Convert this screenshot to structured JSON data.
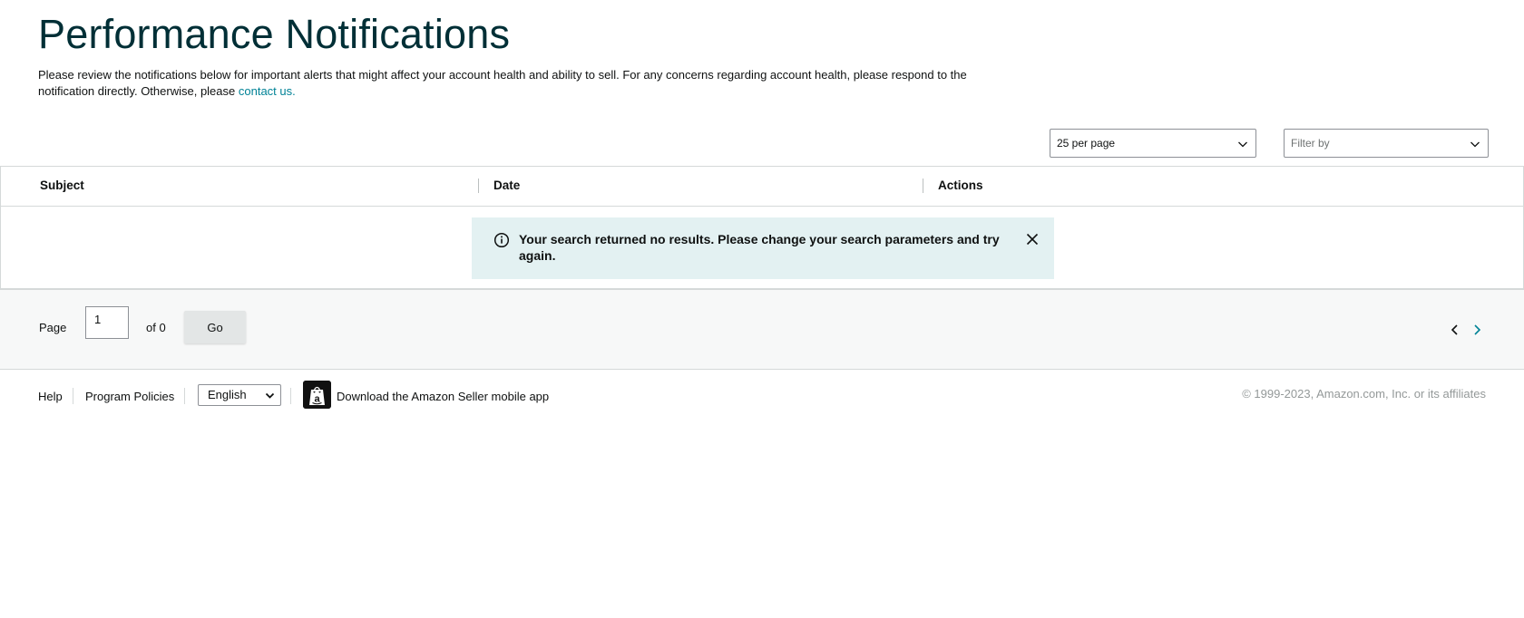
{
  "header": {
    "title": "Performance Notifications",
    "intro_text": "Please review the notifications below for important alerts that might affect your account health and ability to sell. For any concerns regarding account health, please respond to the notification directly. Otherwise, please ",
    "contact_link": "contact us."
  },
  "controls": {
    "per_page": "25 per page",
    "filter_placeholder": "Filter by"
  },
  "table": {
    "columns": [
      "Subject",
      "Date",
      "Actions"
    ],
    "rows": []
  },
  "alert": {
    "type": "info",
    "message": "Your search returned no results. Please change your search parameters and try again.",
    "icon": "info-icon",
    "close_icon": "close-icon"
  },
  "pagination": {
    "page_label": "Page",
    "current_page": "1",
    "of_label": "of 0",
    "go_label": "Go"
  },
  "footer": {
    "help": "Help",
    "program_policies": "Program Policies",
    "language": "English",
    "app_link": "Download the Amazon Seller mobile app",
    "copyright": "© 1999-2023, Amazon.com, Inc. or its affiliates"
  },
  "colors": {
    "title": "#002f36",
    "link": "#008296",
    "alert_bg": "#e3f1f2",
    "pager_bg": "#f7f8f8"
  }
}
